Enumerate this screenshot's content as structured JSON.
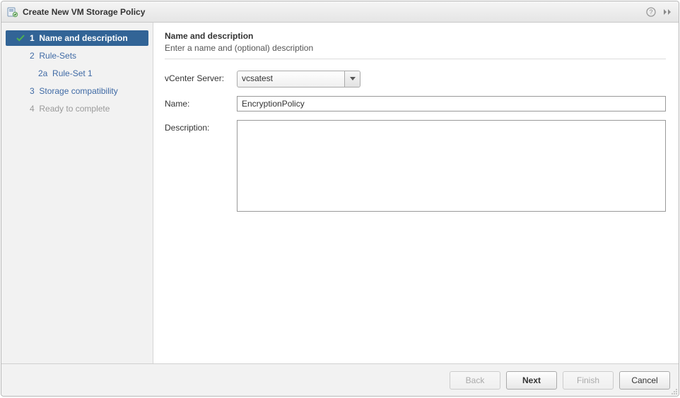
{
  "window": {
    "title": "Create New VM Storage Policy"
  },
  "sidebar": {
    "steps": [
      {
        "num": "1",
        "label": "Name and description",
        "active": true,
        "checked": true
      },
      {
        "num": "2",
        "label": "Rule-Sets"
      },
      {
        "num": "2a",
        "label": "Rule-Set 1",
        "sub": true
      },
      {
        "num": "3",
        "label": "Storage compatibility"
      },
      {
        "num": "4",
        "label": "Ready to complete",
        "disabled": true
      }
    ]
  },
  "main": {
    "heading": "Name and description",
    "subheading": "Enter a name and (optional) description",
    "vcenter_label": "vCenter Server:",
    "vcenter_value": "vcsatest",
    "name_label": "Name:",
    "name_value": "EncryptionPolicy",
    "description_label": "Description:",
    "description_value": ""
  },
  "footer": {
    "back": "Back",
    "next": "Next",
    "finish": "Finish",
    "cancel": "Cancel"
  }
}
